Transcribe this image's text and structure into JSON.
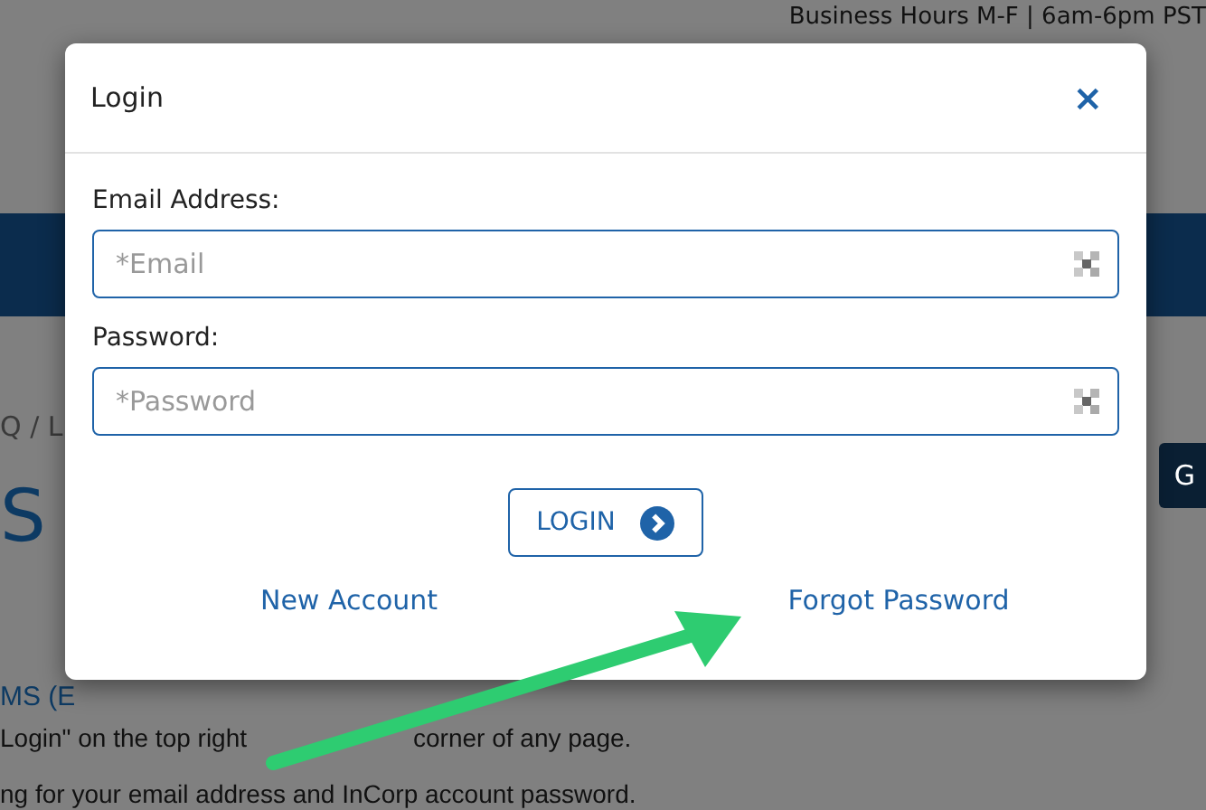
{
  "background": {
    "business_hours": "Business Hours M-F | 6am-6pm PST",
    "breadcrumb": "Q / L",
    "heading": "S",
    "button": "G",
    "section_title": "MS (E",
    "paragraphs": [
      [
        "Login\" on the top right",
        "corner of any page."
      ],
      [
        "ng for your email address and InCorp account password."
      ]
    ]
  },
  "dialog": {
    "title": "Login",
    "close": "×",
    "fields": [
      {
        "label": "Email Address:",
        "placeholder": "*Email"
      },
      {
        "label": "Password:",
        "placeholder": "*Password"
      }
    ],
    "login_button": "LOGIN",
    "links": [
      "New Account",
      "Forgot Password"
    ]
  }
}
